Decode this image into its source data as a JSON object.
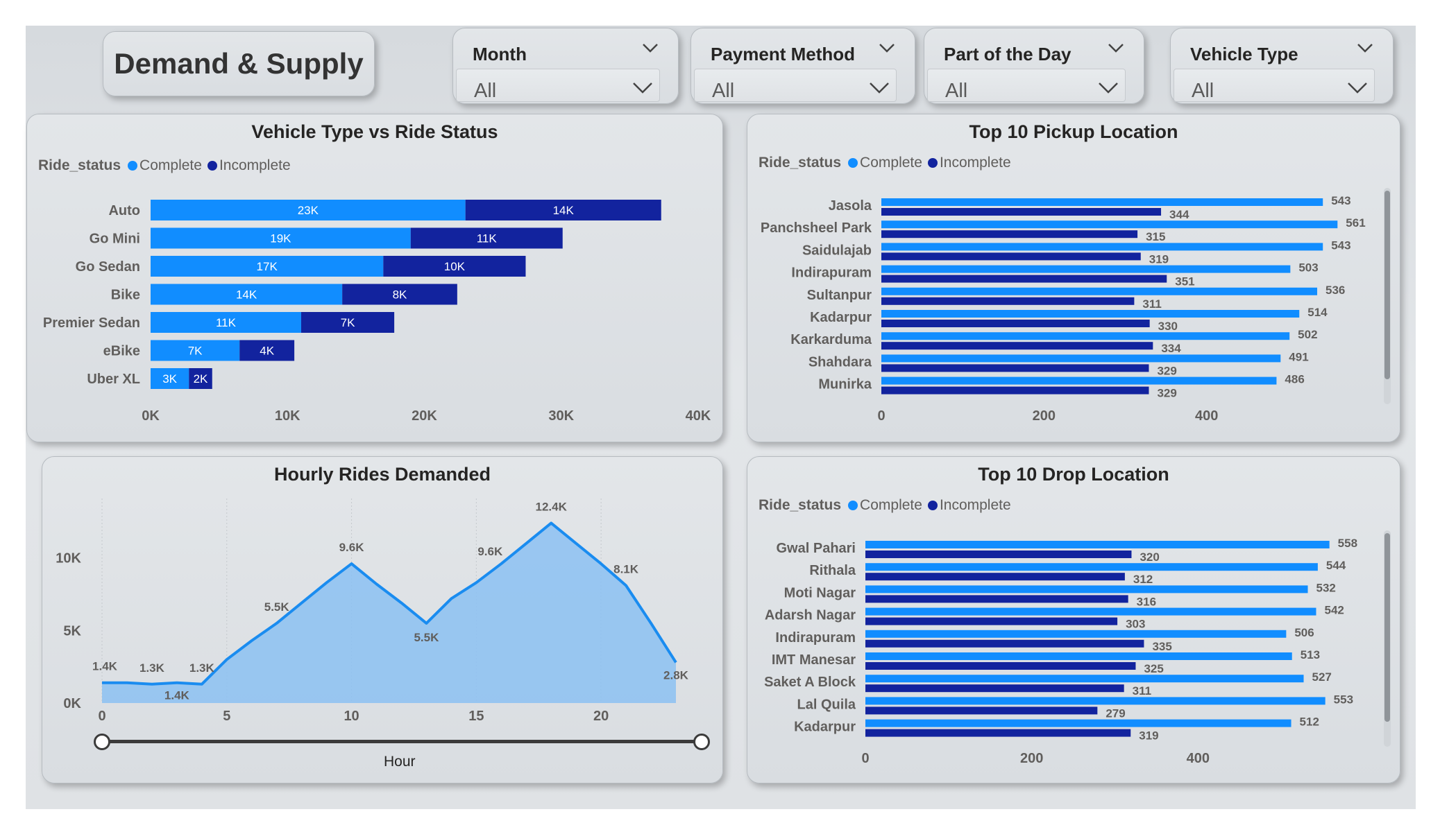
{
  "title": "Demand & Supply",
  "slicers": [
    {
      "label": "Month",
      "value": "All"
    },
    {
      "label": "Payment Method",
      "value": "All"
    },
    {
      "label": "Part of the Day",
      "value": "All"
    },
    {
      "label": "Vehicle Type",
      "value": "All"
    }
  ],
  "legend": {
    "title": "Ride_status",
    "complete": "Complete",
    "incomplete": "Incomplete"
  },
  "colors": {
    "complete": "#118DFF",
    "incomplete": "#12239E",
    "area_line": "#1a8cf0",
    "area_fill": "#8cc1f2"
  },
  "chart_data": [
    {
      "type": "bar",
      "title": "Vehicle Type vs Ride Status",
      "stacked": true,
      "orientation": "horizontal",
      "categories": [
        "Auto",
        "Go Mini",
        "Go Sedan",
        "Bike",
        "Premier Sedan",
        "eBike",
        "Uber XL"
      ],
      "series": [
        {
          "name": "Complete",
          "values": [
            23000,
            19000,
            17000,
            14000,
            11000,
            6500,
            2800
          ],
          "labels": [
            "23K",
            "19K",
            "17K",
            "14K",
            "11K",
            "7K",
            "3K"
          ]
        },
        {
          "name": "Incomplete",
          "values": [
            14300,
            11100,
            10400,
            8400,
            6800,
            4000,
            1700
          ],
          "labels": [
            "14K",
            "11K",
            "10K",
            "8K",
            "7K",
            "4K",
            "2K"
          ]
        }
      ],
      "xlim": [
        0,
        40000
      ],
      "xticks": [
        "0K",
        "10K",
        "20K",
        "30K",
        "40K"
      ],
      "legend_position": "top-left"
    },
    {
      "type": "bar",
      "title": "Top 10 Pickup Location",
      "orientation": "horizontal",
      "categories": [
        "Jasola",
        "Panchsheel Park",
        "Saidulajab",
        "Indirapuram",
        "Sultanpur",
        "Kadarpur",
        "Karkarduma",
        "Shahdara",
        "Munirka"
      ],
      "series": [
        {
          "name": "Complete",
          "values": [
            543,
            561,
            543,
            503,
            536,
            514,
            502,
            491,
            486
          ]
        },
        {
          "name": "Incomplete",
          "values": [
            344,
            315,
            319,
            351,
            311,
            330,
            334,
            329,
            329
          ]
        }
      ],
      "xlim": [
        0,
        600
      ],
      "xticks": [
        "0",
        "200",
        "400"
      ],
      "legend_position": "top-left"
    },
    {
      "type": "area",
      "title": "Hourly Rides Demanded",
      "xlabel": "Hour",
      "x": [
        0,
        1,
        2,
        3,
        4,
        5,
        6,
        7,
        8,
        9,
        10,
        11,
        12,
        13,
        14,
        15,
        16,
        17,
        18,
        19,
        20,
        21,
        22,
        23
      ],
      "values": [
        1400,
        1400,
        1300,
        1400,
        1300,
        3000,
        4300,
        5500,
        6900,
        8300,
        9600,
        8200,
        6900,
        5500,
        7200,
        8300,
        9600,
        11000,
        12400,
        11000,
        9600,
        8100,
        5500,
        2800
      ],
      "point_labels": [
        {
          "x": 0,
          "label": "1.4K"
        },
        {
          "x": 2,
          "label": "1.3K"
        },
        {
          "x": 3,
          "label": "1.4K"
        },
        {
          "x": 4,
          "label": "1.3K"
        },
        {
          "x": 7,
          "label": "5.5K"
        },
        {
          "x": 10,
          "label": "9.6K"
        },
        {
          "x": 13,
          "label": "5.5K"
        },
        {
          "x": 16,
          "label": "9.6K"
        },
        {
          "x": 18,
          "label": "12.4K"
        },
        {
          "x": 21,
          "label": "8.1K"
        },
        {
          "x": 23,
          "label": "2.8K"
        }
      ],
      "ylim": [
        0,
        14000
      ],
      "yticks": [
        "0K",
        "5K",
        "10K"
      ],
      "xticks": [
        "0",
        "5",
        "10",
        "15",
        "20"
      ],
      "grid": "vertical"
    },
    {
      "type": "bar",
      "title": "Top 10 Drop Location",
      "orientation": "horizontal",
      "categories": [
        "Gwal Pahari",
        "Rithala",
        "Moti Nagar",
        "Adarsh Nagar",
        "Indirapuram",
        "IMT Manesar",
        "Saket A Block",
        "Lal Quila",
        "Kadarpur"
      ],
      "series": [
        {
          "name": "Complete",
          "values": [
            558,
            544,
            532,
            542,
            506,
            513,
            527,
            553,
            512
          ]
        },
        {
          "name": "Incomplete",
          "values": [
            320,
            312,
            316,
            303,
            335,
            325,
            311,
            279,
            319
          ]
        }
      ],
      "xlim": [
        0,
        600
      ],
      "xticks": [
        "0",
        "200",
        "400"
      ],
      "legend_position": "top-left"
    }
  ]
}
